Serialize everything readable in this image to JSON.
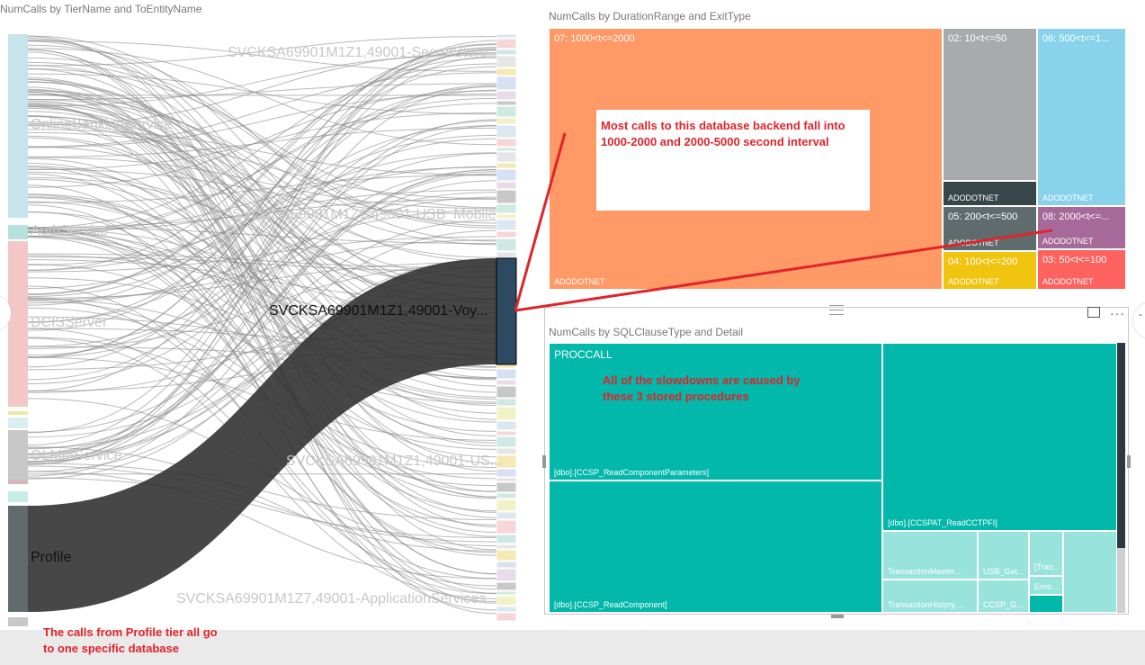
{
  "sankey": {
    "title": "NumCalls by TierName and ToEntityName",
    "left_nodes": [
      "OnlineBankingService",
      "AuthService",
      "DCISServer",
      "OLMMService",
      "Profile"
    ],
    "right_labels": [
      "SVCKSA69901M1Z1,49001-SecretStore",
      "SVCKSA69901M1Z1,49001-USB_Mobile",
      "SVCKSA69901M1Z1,49001-Voy...",
      "SVCKSA69901M1Z1,49001-US...",
      "SVCKSA69901M1Z7,49001-ApplicationServices"
    ]
  },
  "duration_treemap": {
    "title": "NumCalls by DurationRange and ExitType",
    "tiles": [
      {
        "range": "07: 1000<t<=2000",
        "exit": "ADODOTNET",
        "color": "#ff9966"
      },
      {
        "range": "02: 10<t<=50",
        "exit": "ADODOTNET",
        "color": "#a7abac"
      },
      {
        "range": "06: 500<t<=1...",
        "exit": "ADODOTNET",
        "color": "#88d3eb"
      },
      {
        "range": "05: 200<t<=500",
        "exit": "ADODOTNET",
        "color": "#5f6b6d"
      },
      {
        "range": "08: 2000<t<=...",
        "exit": "ADODOTNET",
        "color": "#a66999"
      },
      {
        "range": "04: 100<t<=200",
        "exit": "ADODOTNET",
        "color": "#f1c40f"
      },
      {
        "range": "03: 50<t<=100",
        "exit": "ADODOTNET",
        "color": "#fd625e"
      }
    ],
    "strip_color": "#374649"
  },
  "sql_treemap": {
    "title": "NumCalls by SQLClauseType and Detail",
    "group": "PROCCALL",
    "tiles": [
      {
        "label": "[dbo].[CCSP_ReadComponentParameters]"
      },
      {
        "label": "[dbo].[CCSP_ReadComponent]"
      },
      {
        "label": "[dbo].[CCSPAT_ReadCCTPFI]"
      },
      {
        "label": "TransactionMaster...."
      },
      {
        "label": "TransactionHistory...."
      },
      {
        "label": "USB_Get..."
      },
      {
        "label": "CCSP_G..."
      },
      {
        "label": "[Tran..."
      },
      {
        "label": "Enro..."
      }
    ],
    "colors": {
      "main": "#01b8aa",
      "light": "#99e3dd"
    }
  },
  "annotations": {
    "database": "Most calls to this database backend fall into 1000-2000 and 2000-5000 second interval",
    "procedures": "All of the slowdowns are caused by these 3 stored procedures",
    "profile": "The calls from Profile tier all go to one specific database"
  },
  "toolbar": {
    "more_label": "···",
    "grip_label": "⇌",
    "focus_icon": "focus-mode-icon"
  }
}
